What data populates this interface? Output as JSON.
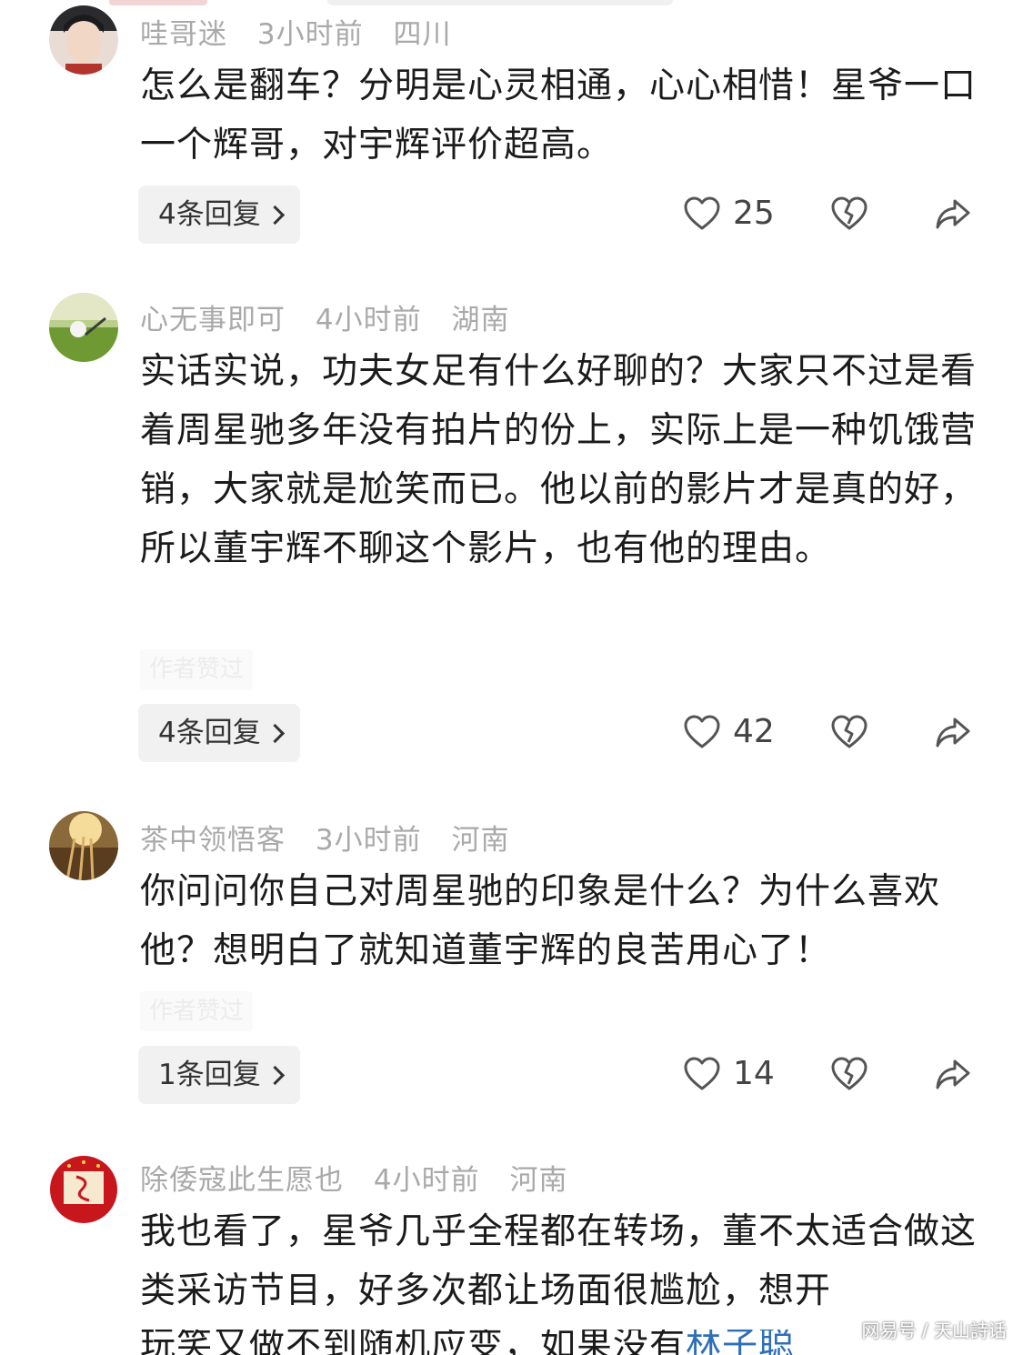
{
  "comments": [
    {
      "username": "哇哥迷",
      "time": "3小时前",
      "location": "四川",
      "text": "怎么是翻车？分明是心灵相通，心心相惜！星爷一口一个辉哥，对宇辉评价超高。",
      "author_liked": "",
      "replies": "4条回复",
      "likes": "25"
    },
    {
      "username": "心无事即可",
      "time": "4小时前",
      "location": "湖南",
      "text": "实话实说，功夫女足有什么好聊的？大家只不过是看着周星驰多年没有拍片的份上，实际上是一种饥饿营销，大家就是尬笑而已。他以前的影片才是真的好，所以董宇辉不聊这个影片，也有他的理由。",
      "author_liked": "作者赞过",
      "replies": "4条回复",
      "likes": "42"
    },
    {
      "username": "茶中领悟客",
      "time": "3小时前",
      "location": "河南",
      "text": "你问问你自己对周星驰的印象是什么？为什么喜欢他？想明白了就知道董宇辉的良苦用心了！",
      "author_liked": "作者赞过",
      "replies": "1条回复",
      "likes": "14"
    },
    {
      "username": "除倭寇此生愿也",
      "time": "4小时前",
      "location": "河南",
      "text": "我也看了，星爷几乎全程都在转场，董不太适合做这类采访节目，好多次都让场面很尴尬，想开",
      "text_cut": "玩笑又做不到随机应变，如果没有",
      "text_cut_link": "林子聪",
      "author_liked": "",
      "replies": "",
      "likes": ""
    }
  ],
  "watermark": "网易号 / 天山詩话",
  "icons": {
    "like": "heart-outline-icon",
    "dislike": "broken-heart-icon",
    "share": "share-arrow-icon",
    "chevron": "chevron-right-icon"
  },
  "colors": {
    "meta_text": "#a9a9a9",
    "body_text": "#1b1b1b",
    "reply_bg": "#f1f1f1",
    "link": "#2e6fb8"
  }
}
